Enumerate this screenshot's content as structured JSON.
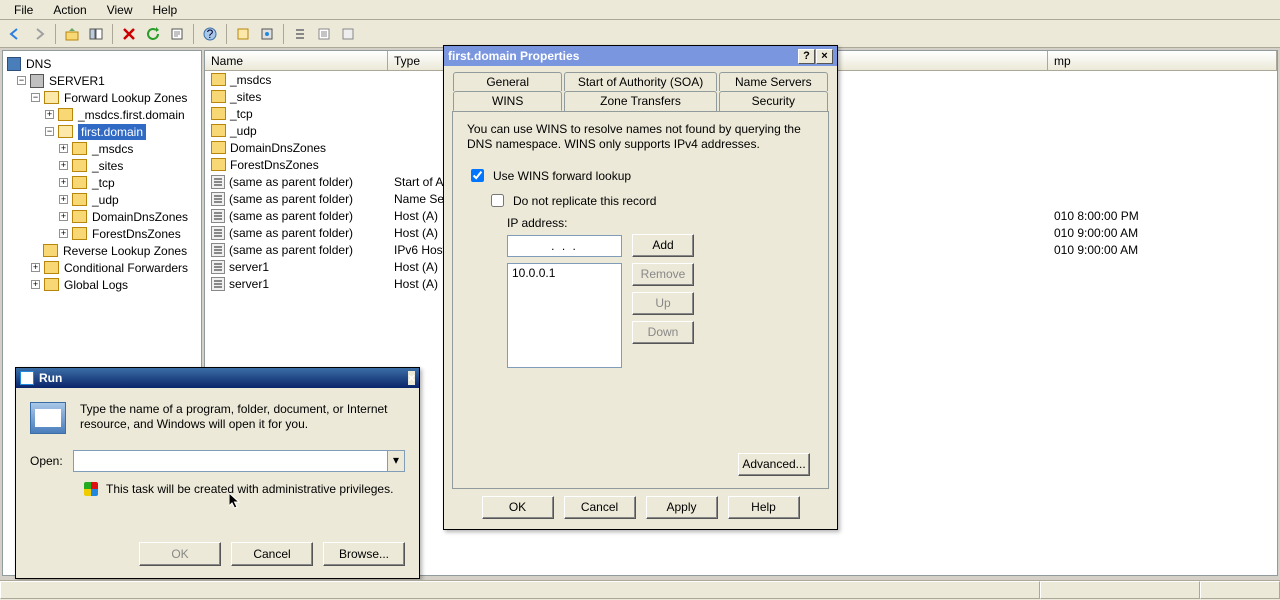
{
  "menubar": {
    "file": "File",
    "action": "Action",
    "view": "View",
    "help": "Help"
  },
  "tree": {
    "root": "DNS",
    "server": "SERVER1",
    "flz": "Forward Lookup Zones",
    "z1": "_msdcs.first.domain",
    "z2": "first.domain",
    "z2_children": {
      "msdcs": "_msdcs",
      "sites": "_sites",
      "tcp": "_tcp",
      "udp": "_udp",
      "ddz": "DomainDnsZones",
      "fdz": "ForestDnsZones"
    },
    "rlz": "Reverse Lookup Zones",
    "cf": "Conditional Forwarders",
    "gl": "Global Logs"
  },
  "list": {
    "cols": {
      "name": "Name",
      "type": "Type",
      "ts": "mp"
    },
    "rows": [
      {
        "i": "f",
        "name": "_msdcs",
        "type": "",
        "ts": ""
      },
      {
        "i": "f",
        "name": "_sites",
        "type": "",
        "ts": ""
      },
      {
        "i": "f",
        "name": "_tcp",
        "type": "",
        "ts": ""
      },
      {
        "i": "f",
        "name": "_udp",
        "type": "",
        "ts": ""
      },
      {
        "i": "f",
        "name": "DomainDnsZones",
        "type": "",
        "ts": ""
      },
      {
        "i": "f",
        "name": "ForestDnsZones",
        "type": "",
        "ts": ""
      },
      {
        "i": "r",
        "name": "(same as parent folder)",
        "type": "Start of A",
        "ts": ""
      },
      {
        "i": "r",
        "name": "(same as parent folder)",
        "type": "Name Serv",
        "ts": ""
      },
      {
        "i": "r",
        "name": "(same as parent folder)",
        "type": "Host (A)",
        "ts": "010 8:00:00 PM"
      },
      {
        "i": "r",
        "name": "(same as parent folder)",
        "type": "Host (A)",
        "ts": "010 9:00:00 AM"
      },
      {
        "i": "r",
        "name": "(same as parent folder)",
        "type": "IPv6 Host",
        "ts": "010 9:00:00 AM"
      },
      {
        "i": "r",
        "name": "server1",
        "type": "Host (A)",
        "ts": ""
      },
      {
        "i": "r",
        "name": "server1",
        "type": "Host (A)",
        "ts": ""
      }
    ]
  },
  "props": {
    "title": "first.domain Properties",
    "tabs": {
      "general": "General",
      "soa": "Start of Authority (SOA)",
      "ns": "Name Servers",
      "wins": "WINS",
      "zt": "Zone Transfers",
      "sec": "Security"
    },
    "desc": "You can use WINS to resolve names not found by querying the DNS namespace.  WINS only supports IPv4 addresses.",
    "chk_use": "Use WINS forward lookup",
    "chk_norep": "Do not replicate this record",
    "ip_label": "IP address:",
    "ip_field": ".       .       .",
    "ip_entry": "10.0.0.1",
    "btn_add": "Add",
    "btn_remove": "Remove",
    "btn_up": "Up",
    "btn_down": "Down",
    "btn_adv": "Advanced...",
    "btn_ok": "OK",
    "btn_cancel": "Cancel",
    "btn_apply": "Apply",
    "btn_help": "Help"
  },
  "run": {
    "title": "Run",
    "desc": "Type the name of a program, folder, document, or Internet resource, and Windows will open it for you.",
    "open": "Open:",
    "admin": "This task will be created with administrative privileges.",
    "ok": "OK",
    "cancel": "Cancel",
    "browse": "Browse..."
  }
}
